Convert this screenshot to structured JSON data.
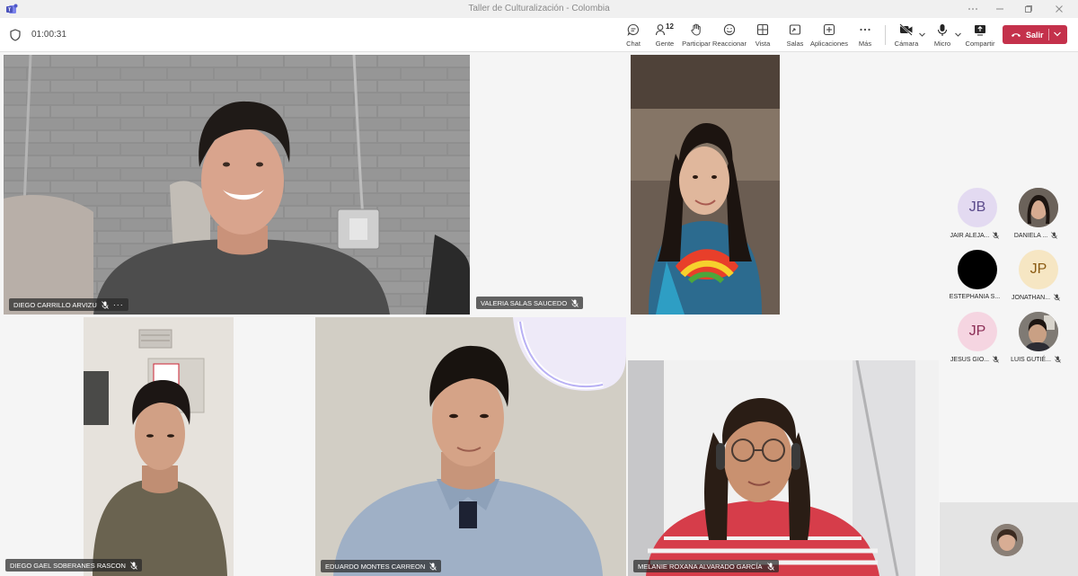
{
  "window": {
    "title": "Taller de Culturalización - Colombia"
  },
  "meeting": {
    "timer": "01:00:31"
  },
  "toolbar": {
    "chat": "Chat",
    "people": "Gente",
    "people_count": "12",
    "raise": "Participar",
    "react": "Reaccionar",
    "view": "Vista",
    "rooms": "Salas",
    "apps": "Aplicaciones",
    "more": "Más",
    "camera": "Cámara",
    "mic": "Micro",
    "share": "Compartir",
    "leave": "Salir"
  },
  "tiles": [
    {
      "name": "DIEGO CARRILLO ARVIZU"
    },
    {
      "name": "VALERIA SALAS SAUCEDO"
    },
    {
      "name": "DIEGO GAEL SOBERANES RASCON"
    },
    {
      "name": "EDUARDO MONTES CARREON"
    },
    {
      "name": "MELANIE ROXANA ALVARADO GARCÍA"
    }
  ],
  "roster": [
    {
      "initials": "JB",
      "name": "JAIR ALEJA..."
    },
    {
      "initials": "",
      "name": "DANIELA ..."
    },
    {
      "initials": "",
      "name": "ESTEPHANIA S..."
    },
    {
      "initials": "JP",
      "name": "JONATHAN..."
    },
    {
      "initials": "JP",
      "name": "JESUS GIO..."
    },
    {
      "initials": "",
      "name": "LUIS GUTIÉ..."
    }
  ],
  "colors": {
    "accent": "#6264a7",
    "leave": "#c4314b",
    "avatar_purple_bg": "#e3daf1",
    "avatar_purple_fg": "#5b4a8b",
    "avatar_pink_bg": "#f5d5e1",
    "avatar_pink_fg": "#8b2d55",
    "avatar_gold_bg": "#f6e6c3",
    "avatar_gold_fg": "#8a5a12"
  }
}
